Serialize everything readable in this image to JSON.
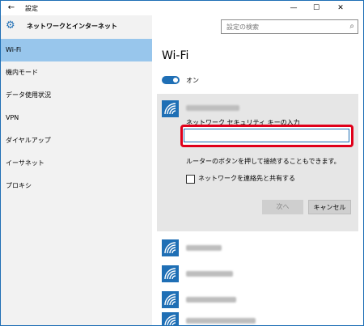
{
  "titlebar": {
    "back_icon": "back-arrow-icon",
    "title": "設定",
    "minimize_icon": "minimize-icon",
    "maximize_icon": "maximize-icon",
    "close_icon": "close-icon"
  },
  "sidebar": {
    "icon": "gear-icon",
    "title": "ネットワークとインターネット",
    "items": [
      {
        "label": "Wi-Fi",
        "active": true
      },
      {
        "label": "機内モード",
        "active": false
      },
      {
        "label": "データ使用状況",
        "active": false
      },
      {
        "label": "VPN",
        "active": false
      },
      {
        "label": "ダイヤルアップ",
        "active": false
      },
      {
        "label": "イーサネット",
        "active": false
      },
      {
        "label": "プロキシ",
        "active": false
      }
    ]
  },
  "search": {
    "placeholder": "設定の検索",
    "icon": "search-icon"
  },
  "main": {
    "heading": "Wi-Fi",
    "toggle_label": "オン",
    "toggle_on": true,
    "expanded_network": {
      "security_key_label": "ネットワーク セキュリティ キーの入力",
      "password_value": "",
      "router_hint": "ルーターのボタンを押して接続することもできます。",
      "share_label": "ネットワークを連絡先と共有する",
      "share_checked": false,
      "next_label": "次へ",
      "cancel_label": "キャンセル"
    }
  },
  "colors": {
    "accent": "#1f6fb5",
    "sidebar_active": "#98c6ec",
    "highlight_border": "#e0001a"
  }
}
